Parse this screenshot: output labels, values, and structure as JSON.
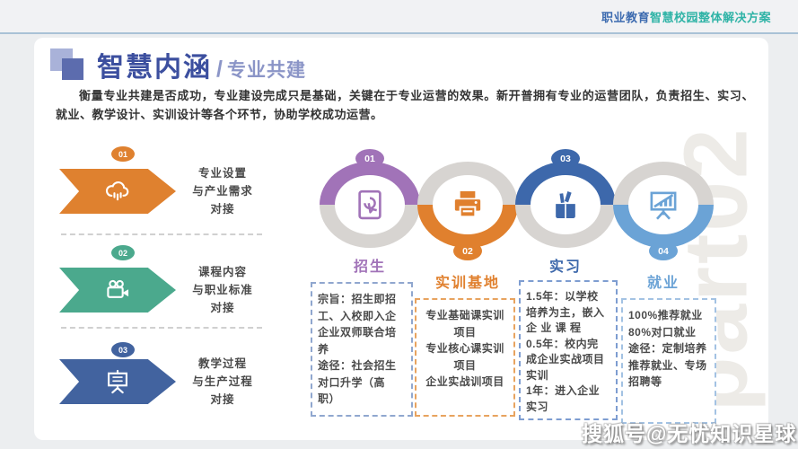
{
  "header": {
    "brand_part1": "职业教育",
    "brand_part2": "智慧校园整体解决方案"
  },
  "title": {
    "main": "智慧内涵",
    "separator": "/",
    "subtitle": "专业共建"
  },
  "intro": "衡量专业共建是否成功，专业建设完成只是基础，关键在于专业运营的效果。新开普拥有专业的运营团队，负责招生、实习、就业、教学设计、实训设计等各个环节，协助学校成功运营。",
  "steps": [
    {
      "number": "01",
      "icon": "cloud-rain-icon",
      "color": "#df812f",
      "lines": [
        "专业设置",
        "与产业需求",
        "对接"
      ]
    },
    {
      "number": "02",
      "icon": "video-camera-icon",
      "color": "#4ba98d",
      "lines": [
        "课程内容",
        "与职业标准",
        "对接"
      ]
    },
    {
      "number": "03",
      "icon": "easel-board-icon",
      "color": "#42639f",
      "lines": [
        "教学过程",
        "与生产过程",
        "对接"
      ]
    }
  ],
  "process": {
    "columns": [
      {
        "number": "01",
        "label": "招生",
        "icon": "touch-screen-icon",
        "color": "#a173b8",
        "badge_position": "top",
        "box_lines": [
          "宗旨：招生即招",
          "工、入校即入企",
          "企业双师联合培",
          "养",
          "途径：社会招生",
          "对口升学（高",
          "职）"
        ]
      },
      {
        "number": "02",
        "label": "实训基地",
        "icon": "printer-icon",
        "color": "#e0802e",
        "badge_position": "bottom",
        "box_lines": [
          "专业基础课实训",
          "项目",
          "专业核心课实训",
          "项目",
          "企业实战训项目"
        ]
      },
      {
        "number": "03",
        "label": "实习",
        "icon": "pen-holder-icon",
        "color": "#3d68ab",
        "badge_position": "top",
        "box_lines": [
          "1.5年：以学校",
          "培养为主，嵌入",
          "企 业 课 程",
          "0.5年：校内完",
          "成企业实战项目",
          "实训",
          "1年：进入企业",
          "实习"
        ]
      },
      {
        "number": "04",
        "label": "就业",
        "icon": "presentation-chart-icon",
        "color": "#6ba3d6",
        "badge_position": "bottom",
        "box_lines": [
          "100%推荐就业",
          "80%对口就业",
          "途径：定制培养",
          "推荐就业、专场",
          "招聘等"
        ]
      }
    ]
  },
  "watermarks": {
    "background": "part02",
    "bottom": "搜狐号@无忧知识星球"
  },
  "colors": {
    "brand_blue": "#3e6cb0",
    "brand_teal": "#2fb3a6",
    "title_dark": "#3c4f9f",
    "title_light": "#8b95c7",
    "ring_gray": "#d7d4d1",
    "card_bg": "#ffffff",
    "page_bg": "#eceef0"
  }
}
